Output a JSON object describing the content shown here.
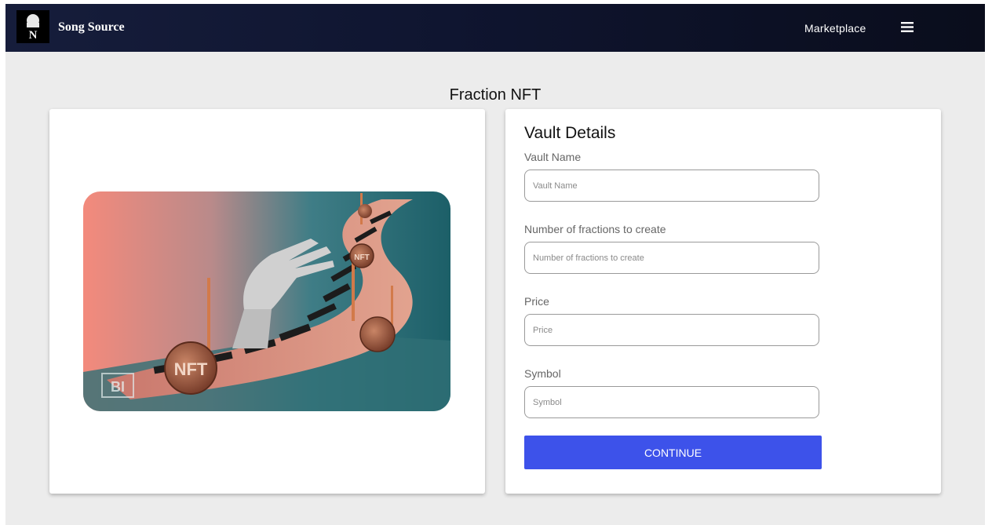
{
  "header": {
    "brand": "Song Source",
    "nav_marketplace": "Marketplace",
    "logo_icon": "song-source-logo",
    "menu_icon": "hamburger-menu-icon"
  },
  "page": {
    "title": "Fraction NFT"
  },
  "image_card": {
    "image": "nft-piano-hand-artwork",
    "coin_label_large": "NFT",
    "coin_label_small": "NFT",
    "watermark": "BI"
  },
  "form": {
    "title": "Vault Details",
    "fields": [
      {
        "label": "Vault Name",
        "placeholder": "Vault Name",
        "value": ""
      },
      {
        "label": "Number of fractions to create",
        "placeholder": "Number of fractions to create",
        "value": ""
      },
      {
        "label": "Price",
        "placeholder": "Price",
        "value": ""
      },
      {
        "label": "Symbol",
        "placeholder": "Symbol",
        "value": ""
      }
    ],
    "submit_label": "CONTINUE"
  },
  "colors": {
    "navbar": "#121833",
    "background": "#ececec",
    "accent_button": "#3d52ea"
  }
}
